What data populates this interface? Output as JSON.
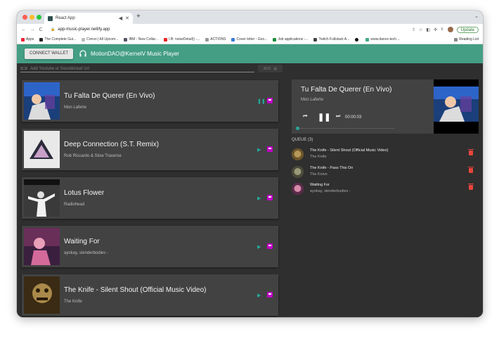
{
  "browser": {
    "tab_title": "React App",
    "url": "app-music-player.netlify.app",
    "update_label": "Update",
    "bookmarks": [
      "Apps",
      "The Complete Gui...",
      "Convo | All Upcom...",
      "IBM - New Collar...",
      "I.B: noiseDetail() -...",
      "ACTIONS",
      "Cover letter - Goo...",
      "Job applications -...",
      "Twitch Fullstack A...",
      "www.dance-tech...."
    ],
    "reading_list": "Reading List"
  },
  "header": {
    "connect_wallet": "CONNECT WALLET",
    "title": "MotionDAO@KernelV Music Player",
    "bg_color": "#449e84"
  },
  "search": {
    "placeholder": "Add Youtube or Soundcloud Url",
    "add_label": "ADD"
  },
  "tracks": [
    {
      "title": "Tu Falta De Querer (En Vivo)",
      "artist": "Mon Laferte",
      "state": "pause"
    },
    {
      "title": "Deep Connection (S.T. Remix)",
      "artist": "Rob Riccardo & Slow Traverse",
      "state": "play"
    },
    {
      "title": "Lotus Flower",
      "artist": "Radiohead",
      "state": "play"
    },
    {
      "title": "Waiting For",
      "artist": "ayokay, slenderbodies -",
      "state": "play"
    },
    {
      "title": "The Knife - Silent Shout (Official Music Video)",
      "artist": "The Knife",
      "state": "play"
    }
  ],
  "now_playing": {
    "title": "Tu Falta De Querer (En Vivo)",
    "artist": "Mon Laferte",
    "time": "00:00:03",
    "progress": 0.02
  },
  "queue": {
    "header": "QUEUE (3)",
    "items": [
      {
        "title": "The Knife - Silent Shout (Official Music Video)",
        "artist": "The Knife"
      },
      {
        "title": "The Knife - Pass This On",
        "artist": "The Knive"
      },
      {
        "title": "Waiting For",
        "artist": "ayokay, slenderbodies -"
      }
    ]
  },
  "colors": {
    "play": "#26a69a",
    "save": "#c000c6",
    "delete": "#e8453c"
  }
}
